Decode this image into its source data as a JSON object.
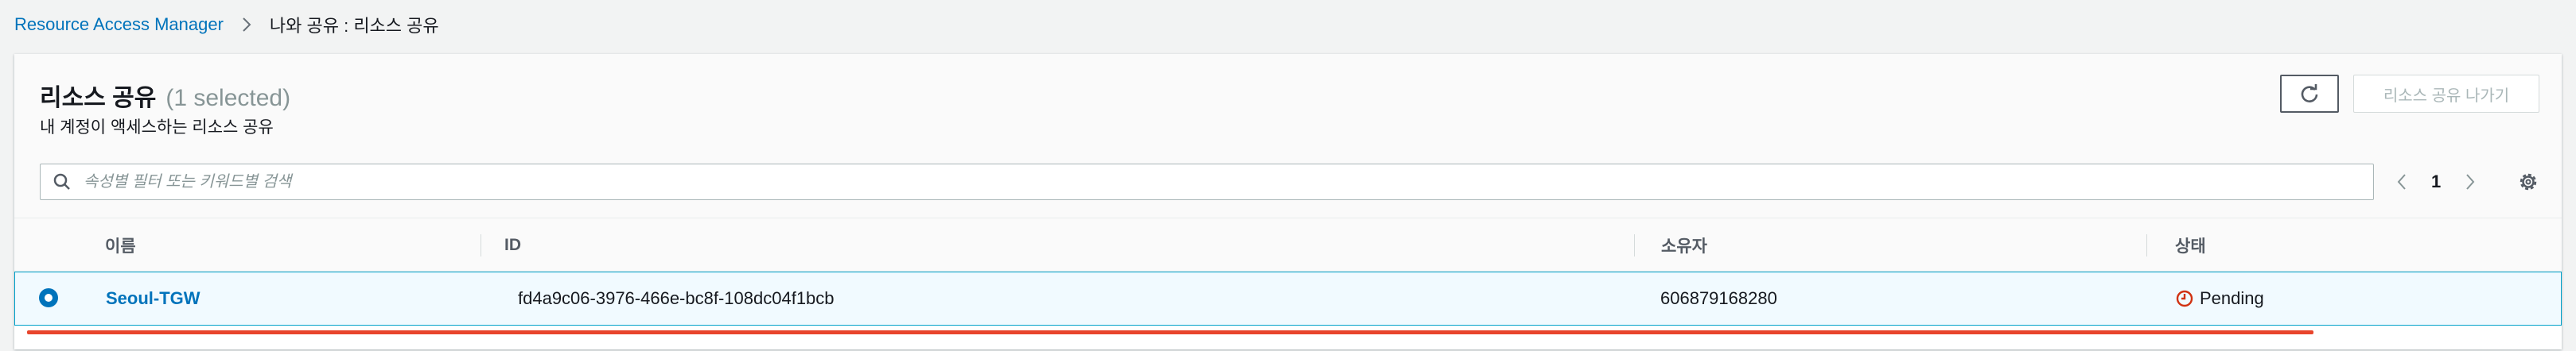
{
  "breadcrumb": {
    "root": "Resource Access Manager",
    "current": "나와 공유 : 리소스 공유"
  },
  "panel": {
    "title": "리소스 공유",
    "selected_count": "(1 selected)",
    "subtitle": "내 계정이 액세스하는 리소스 공유",
    "refresh_icon": "refresh-icon",
    "leave_button": "리소스 공유 나가기"
  },
  "search": {
    "placeholder": "속성별 필터 또는 키워드별 검색",
    "icon": "search-icon"
  },
  "pagination": {
    "current_page": "1",
    "prev_icon": "chevron-left-icon",
    "next_icon": "chevron-right-icon"
  },
  "settings_icon": "gear-icon",
  "table": {
    "columns": [
      "이름",
      "ID",
      "소유자",
      "상태"
    ],
    "rows": [
      {
        "selected": true,
        "name": "Seoul-TGW",
        "id": "fd4a9c06-3976-466e-bc8f-108dc04f1bcb",
        "owner": "606879168280",
        "status": "Pending",
        "status_icon": "clock-icon"
      }
    ]
  },
  "colors": {
    "link": "#0073bb",
    "selected_row_bg": "#f1faff",
    "selected_row_border": "#00a1c9",
    "pending": "#d13212",
    "annotation_underline": "#e8452c"
  }
}
